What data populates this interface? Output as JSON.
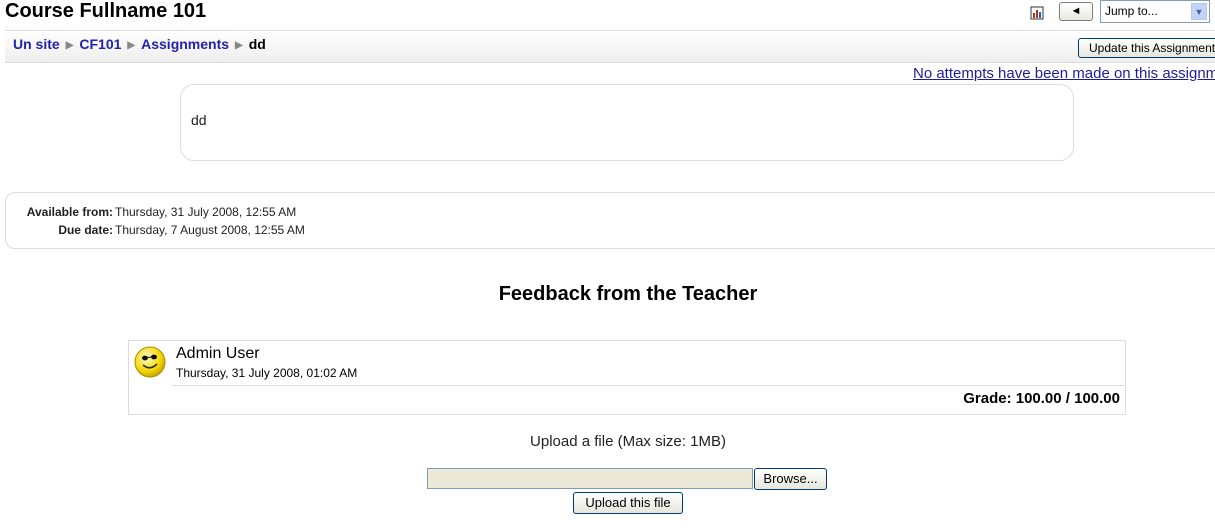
{
  "header": {
    "course_title": "Course Fullname 101",
    "prev_button": "◄",
    "jump_to": "Jump to..."
  },
  "breadcrumb": {
    "items": [
      "Un site",
      "CF101",
      "Assignments"
    ],
    "current": "dd",
    "separator": "▶"
  },
  "update_button": "Update this Assignment",
  "attempts_link": "No attempts have been made on this assignment",
  "intro": {
    "text": "dd"
  },
  "dates": {
    "available_label": "Available from:",
    "available_value": "Thursday, 31 July 2008, 12:55 AM",
    "due_label": "Due date:",
    "due_value": "Thursday, 7 August 2008, 12:55 AM"
  },
  "feedback": {
    "heading": "Feedback from the Teacher",
    "author": "Admin User",
    "date": "Thursday, 31 July 2008, 01:02 AM",
    "grade": "Grade: 100.00 / 100.00"
  },
  "upload": {
    "label": "Upload a file (Max size: 1MB)",
    "browse_button": "Browse...",
    "submit_button": "Upload this file"
  },
  "icons": {
    "log": "log-icon",
    "avatar": "smiley-avatar",
    "dropdown": "chevron-down-icon"
  },
  "colors": {
    "link": "#2222aa",
    "border": "#dddddd"
  }
}
